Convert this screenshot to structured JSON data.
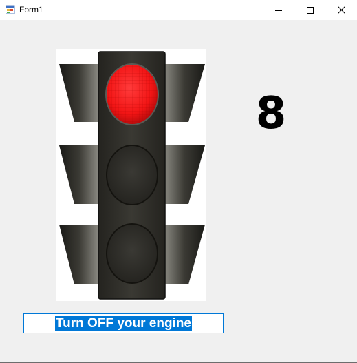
{
  "window": {
    "title": "Form1"
  },
  "titlebar_buttons": {
    "minimize": "minimize-icon",
    "maximize": "maximize-icon",
    "close": "close-icon"
  },
  "traffic_light": {
    "active_lamp": "red",
    "colors": {
      "red": "#ff1a1a",
      "unlit": "#2c2b27",
      "housing": "#2f2e29"
    }
  },
  "countdown": {
    "value": "8"
  },
  "message": {
    "text": "Turn OFF your engine",
    "selection_color": "#0078d7"
  }
}
